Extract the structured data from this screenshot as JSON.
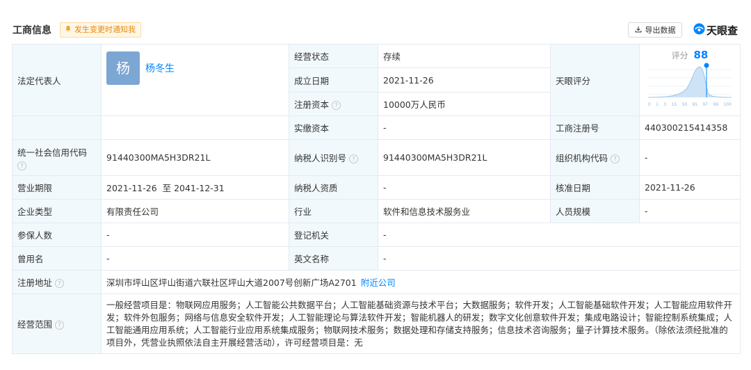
{
  "header": {
    "title": "工商信息",
    "notify_label": "发生变更时通知我",
    "export_label": "导出数据",
    "brand": "天眼查",
    "accent": "#0084ff"
  },
  "legal_rep": {
    "label": "法定代表人",
    "avatar_char": "杨",
    "name": "杨冬生"
  },
  "rows": {
    "status_label": "经营状态",
    "status": "存续",
    "founded_label": "成立日期",
    "founded": "2021-11-26",
    "reg_capital_label": "注册资本",
    "reg_capital": "10000万人民币",
    "paid_capital_label": "实缴资本",
    "paid_capital": "-",
    "tianyan_label": "天眼评分",
    "reg_no_label": "工商注册号",
    "reg_no": "440300215414358",
    "credit_code_label": "统一社会信用代码",
    "credit_code": "91440300MA5H3DR21L",
    "taxpayer_id_label": "纳税人识别号",
    "taxpayer_id": "91440300MA5H3DR21L",
    "org_code_label": "组织机构代码",
    "org_code": "-",
    "term_label": "营业期限",
    "term": "2021-11-26  至 2041-12-31",
    "taxpayer_qual_label": "纳税人资质",
    "taxpayer_qual": "-",
    "approve_label": "核准日期",
    "approve": "2021-11-26",
    "type_label": "企业类型",
    "type": "有限责任公司",
    "industry_label": "行业",
    "industry": "软件和信息技术服务业",
    "staff_label": "人员规模",
    "staff": "-",
    "insured_label": "参保人数",
    "insured": "-",
    "authority_label": "登记机关",
    "authority": "-",
    "former_label": "曾用名",
    "former": "-",
    "en_name_label": "英文名称",
    "en_name": "-",
    "address_label": "注册地址",
    "address": "深圳市坪山区坪山街道六联社区坪山大道2007号创新广场A2701",
    "nearby_label": "附近公司",
    "scope_label": "经营范围",
    "scope": "一般经营项目是：物联网应用服务；人工智能公共数据平台；人工智能基础资源与技术平台；大数据服务；软件开发；人工智能基础软件开发；人工智能应用软件开发；软件外包服务；网络与信息安全软件开发；人工智能理论与算法软件开发；智能机器人的研发；数字文化创意软件开发；集成电路设计；智能控制系统集成；人工智能通用应用系统；人工智能行业应用系统集成服务；物联网技术服务；数据处理和存储支持服务；信息技术咨询服务；量子计算技术服务。（除依法须经批准的项目外，凭营业执照依法自主开展经营活动），许可经营项目是：无"
  },
  "score": {
    "label": "评分",
    "value": "88",
    "ticks": [
      "0",
      "1",
      "3",
      "15",
      "50",
      "65",
      "97",
      "99",
      "100"
    ]
  }
}
